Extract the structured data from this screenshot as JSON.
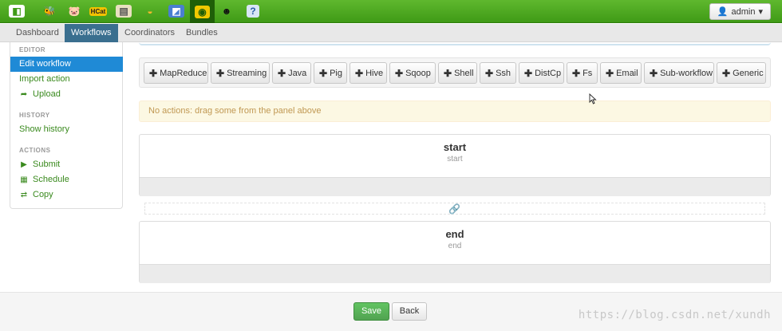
{
  "topbar": {
    "apps": [
      {
        "name": "home-app-icon",
        "glyph": "◧",
        "bg": "#ffffff",
        "fg": "#3f9a16"
      },
      {
        "name": "beeswax-app-icon",
        "glyph": "🐝",
        "bg": "transparent",
        "fg": "#f2c200"
      },
      {
        "name": "pig-app-icon",
        "glyph": "🐷",
        "bg": "transparent",
        "fg": "#f3a0a8"
      },
      {
        "name": "hcat-app-icon",
        "glyph": "HCat",
        "bg": "#f2c200",
        "fg": "#222222"
      },
      {
        "name": "file-browser-icon",
        "glyph": "▤",
        "bg": "#e8e0c0",
        "fg": "#555555"
      },
      {
        "name": "job-designer-icon",
        "glyph": "◒",
        "bg": "transparent",
        "fg": "#f5b82e"
      },
      {
        "name": "job-browser-icon",
        "glyph": "◩",
        "bg": "#4a7fd0",
        "fg": "#ffffff"
      },
      {
        "name": "oozie-app-icon",
        "glyph": "◉",
        "bg": "#f0c800",
        "fg": "#1f5f08"
      },
      {
        "name": "user-admin-icon",
        "glyph": "☻",
        "bg": "transparent",
        "fg": "#111111"
      },
      {
        "name": "help-icon",
        "glyph": "?",
        "bg": "#d8e6f6",
        "fg": "#2a5ea8"
      }
    ],
    "user_label": "admin",
    "user_icon": "user-icon",
    "caret": "▾"
  },
  "subnav": {
    "tabs": [
      "Dashboard",
      "Workflows",
      "Coordinators",
      "Bundles"
    ],
    "active_index": 1
  },
  "sidebar": {
    "editor_header": "EDITOR",
    "edit_workflow": "Edit workflow",
    "import_action": "Import action",
    "upload": "Upload",
    "history_header": "HISTORY",
    "show_history": "Show history",
    "actions_header": "ACTIONS",
    "submit": "Submit",
    "schedule": "Schedule",
    "copy": "Copy"
  },
  "toolbar": {
    "actions": [
      "MapReduce",
      "Streaming",
      "Java",
      "Pig",
      "Hive",
      "Sqoop",
      "Shell",
      "Ssh",
      "DistCp",
      "Fs",
      "Email",
      "Sub-workflow",
      "Generic"
    ]
  },
  "alert": {
    "text": "No actions: drag some from the panel above"
  },
  "nodes": {
    "start_title": "start",
    "start_sub": "start",
    "end_title": "end",
    "end_sub": "end"
  },
  "footer": {
    "save_label": "Save",
    "back_label": "Back"
  },
  "watermark": "https://blog.csdn.net/xundh",
  "colors": {
    "topbar_green": "#4fa821",
    "active_tab": "#3a6f8f",
    "sidebar_active": "#1f8ad6",
    "link_green": "#3a8a1e",
    "alert_bg": "#fcf8e3",
    "save_green": "#51a351"
  }
}
